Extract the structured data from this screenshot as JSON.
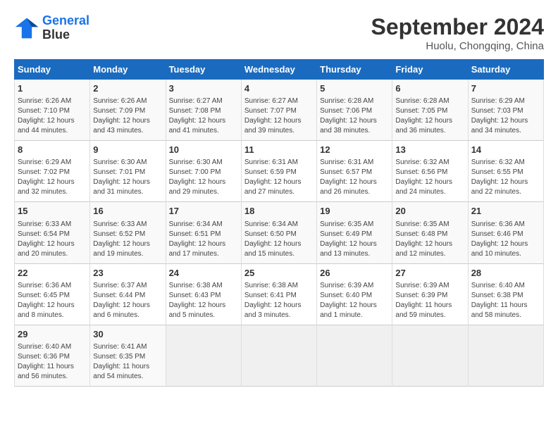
{
  "header": {
    "logo_line1": "General",
    "logo_line2": "Blue",
    "month": "September 2024",
    "location": "Huolu, Chongqing, China"
  },
  "weekdays": [
    "Sunday",
    "Monday",
    "Tuesday",
    "Wednesday",
    "Thursday",
    "Friday",
    "Saturday"
  ],
  "weeks": [
    [
      {
        "day": "1",
        "info": "Sunrise: 6:26 AM\nSunset: 7:10 PM\nDaylight: 12 hours\nand 44 minutes."
      },
      {
        "day": "2",
        "info": "Sunrise: 6:26 AM\nSunset: 7:09 PM\nDaylight: 12 hours\nand 43 minutes."
      },
      {
        "day": "3",
        "info": "Sunrise: 6:27 AM\nSunset: 7:08 PM\nDaylight: 12 hours\nand 41 minutes."
      },
      {
        "day": "4",
        "info": "Sunrise: 6:27 AM\nSunset: 7:07 PM\nDaylight: 12 hours\nand 39 minutes."
      },
      {
        "day": "5",
        "info": "Sunrise: 6:28 AM\nSunset: 7:06 PM\nDaylight: 12 hours\nand 38 minutes."
      },
      {
        "day": "6",
        "info": "Sunrise: 6:28 AM\nSunset: 7:05 PM\nDaylight: 12 hours\nand 36 minutes."
      },
      {
        "day": "7",
        "info": "Sunrise: 6:29 AM\nSunset: 7:03 PM\nDaylight: 12 hours\nand 34 minutes."
      }
    ],
    [
      {
        "day": "8",
        "info": "Sunrise: 6:29 AM\nSunset: 7:02 PM\nDaylight: 12 hours\nand 32 minutes."
      },
      {
        "day": "9",
        "info": "Sunrise: 6:30 AM\nSunset: 7:01 PM\nDaylight: 12 hours\nand 31 minutes."
      },
      {
        "day": "10",
        "info": "Sunrise: 6:30 AM\nSunset: 7:00 PM\nDaylight: 12 hours\nand 29 minutes."
      },
      {
        "day": "11",
        "info": "Sunrise: 6:31 AM\nSunset: 6:59 PM\nDaylight: 12 hours\nand 27 minutes."
      },
      {
        "day": "12",
        "info": "Sunrise: 6:31 AM\nSunset: 6:57 PM\nDaylight: 12 hours\nand 26 minutes."
      },
      {
        "day": "13",
        "info": "Sunrise: 6:32 AM\nSunset: 6:56 PM\nDaylight: 12 hours\nand 24 minutes."
      },
      {
        "day": "14",
        "info": "Sunrise: 6:32 AM\nSunset: 6:55 PM\nDaylight: 12 hours\nand 22 minutes."
      }
    ],
    [
      {
        "day": "15",
        "info": "Sunrise: 6:33 AM\nSunset: 6:54 PM\nDaylight: 12 hours\nand 20 minutes."
      },
      {
        "day": "16",
        "info": "Sunrise: 6:33 AM\nSunset: 6:52 PM\nDaylight: 12 hours\nand 19 minutes."
      },
      {
        "day": "17",
        "info": "Sunrise: 6:34 AM\nSunset: 6:51 PM\nDaylight: 12 hours\nand 17 minutes."
      },
      {
        "day": "18",
        "info": "Sunrise: 6:34 AM\nSunset: 6:50 PM\nDaylight: 12 hours\nand 15 minutes."
      },
      {
        "day": "19",
        "info": "Sunrise: 6:35 AM\nSunset: 6:49 PM\nDaylight: 12 hours\nand 13 minutes."
      },
      {
        "day": "20",
        "info": "Sunrise: 6:35 AM\nSunset: 6:48 PM\nDaylight: 12 hours\nand 12 minutes."
      },
      {
        "day": "21",
        "info": "Sunrise: 6:36 AM\nSunset: 6:46 PM\nDaylight: 12 hours\nand 10 minutes."
      }
    ],
    [
      {
        "day": "22",
        "info": "Sunrise: 6:36 AM\nSunset: 6:45 PM\nDaylight: 12 hours\nand 8 minutes."
      },
      {
        "day": "23",
        "info": "Sunrise: 6:37 AM\nSunset: 6:44 PM\nDaylight: 12 hours\nand 6 minutes."
      },
      {
        "day": "24",
        "info": "Sunrise: 6:38 AM\nSunset: 6:43 PM\nDaylight: 12 hours\nand 5 minutes."
      },
      {
        "day": "25",
        "info": "Sunrise: 6:38 AM\nSunset: 6:41 PM\nDaylight: 12 hours\nand 3 minutes."
      },
      {
        "day": "26",
        "info": "Sunrise: 6:39 AM\nSunset: 6:40 PM\nDaylight: 12 hours\nand 1 minute."
      },
      {
        "day": "27",
        "info": "Sunrise: 6:39 AM\nSunset: 6:39 PM\nDaylight: 11 hours\nand 59 minutes."
      },
      {
        "day": "28",
        "info": "Sunrise: 6:40 AM\nSunset: 6:38 PM\nDaylight: 11 hours\nand 58 minutes."
      }
    ],
    [
      {
        "day": "29",
        "info": "Sunrise: 6:40 AM\nSunset: 6:36 PM\nDaylight: 11 hours\nand 56 minutes."
      },
      {
        "day": "30",
        "info": "Sunrise: 6:41 AM\nSunset: 6:35 PM\nDaylight: 11 hours\nand 54 minutes."
      },
      {
        "day": "",
        "info": ""
      },
      {
        "day": "",
        "info": ""
      },
      {
        "day": "",
        "info": ""
      },
      {
        "day": "",
        "info": ""
      },
      {
        "day": "",
        "info": ""
      }
    ]
  ]
}
